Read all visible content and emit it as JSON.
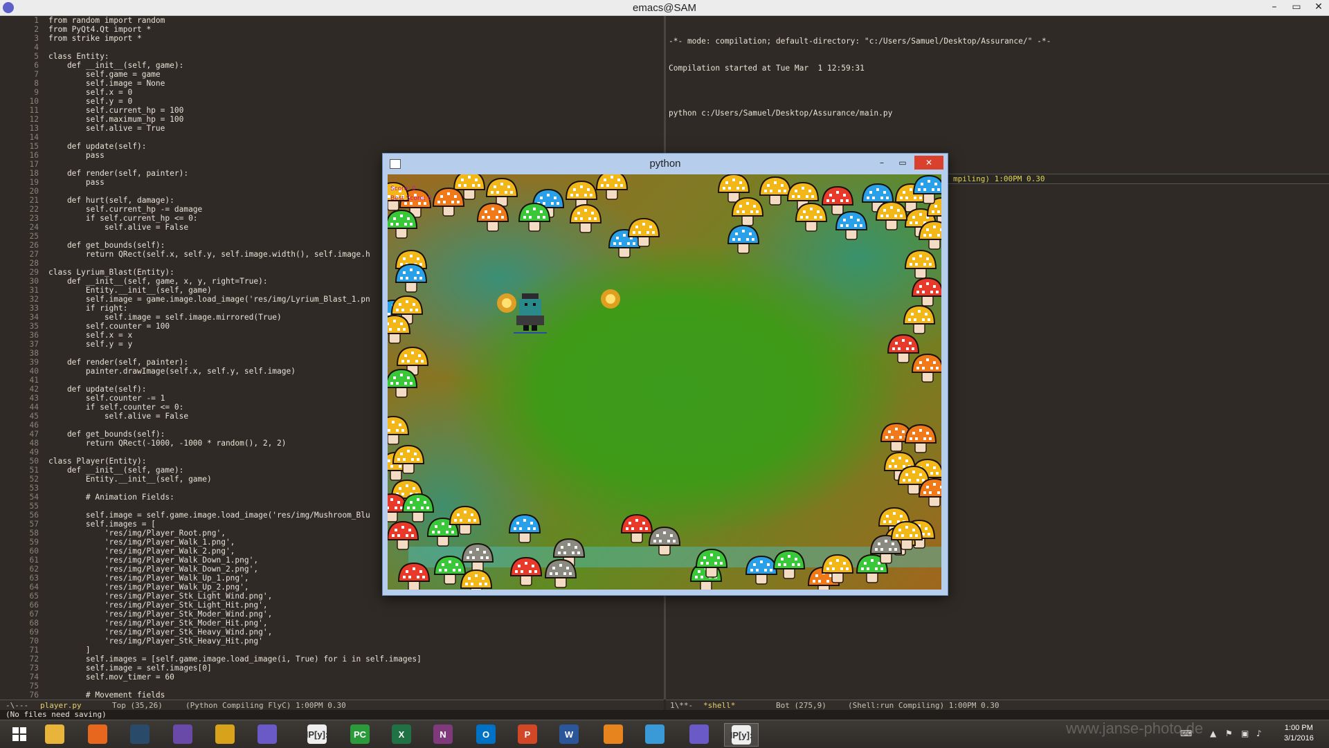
{
  "window": {
    "title": "emacs@SAM",
    "controls": [
      "–",
      "▭",
      "✕"
    ]
  },
  "editor": {
    "lines": [
      {
        "n": "1",
        "t": "from random import random"
      },
      {
        "n": "2",
        "t": "from PyQt4.Qt import *"
      },
      {
        "n": "3",
        "t": "from strike import *"
      },
      {
        "n": "4",
        "t": ""
      },
      {
        "n": "5",
        "t": "class Entity:"
      },
      {
        "n": "6",
        "t": "    def __init__(self, game):"
      },
      {
        "n": "7",
        "t": "        self.game = game"
      },
      {
        "n": "8",
        "t": "        self.image = None"
      },
      {
        "n": "9",
        "t": "        self.x = 0"
      },
      {
        "n": "10",
        "t": "        self.y = 0"
      },
      {
        "n": "11",
        "t": "        self.current_hp = 100"
      },
      {
        "n": "12",
        "t": "        self.maximum_hp = 100"
      },
      {
        "n": "13",
        "t": "        self.alive = True"
      },
      {
        "n": "14",
        "t": ""
      },
      {
        "n": "15",
        "t": "    def update(self):"
      },
      {
        "n": "16",
        "t": "        pass"
      },
      {
        "n": "17",
        "t": ""
      },
      {
        "n": "18",
        "t": "    def render(self, painter):"
      },
      {
        "n": "19",
        "t": "        pass"
      },
      {
        "n": "20",
        "t": ""
      },
      {
        "n": "21",
        "t": "    def hurt(self, damage):"
      },
      {
        "n": "22",
        "t": "        self.current_hp -= damage"
      },
      {
        "n": "23",
        "t": "        if self.current_hp <= 0:"
      },
      {
        "n": "24",
        "t": "            self.alive = False"
      },
      {
        "n": "25",
        "t": ""
      },
      {
        "n": "26",
        "t": "    def get_bounds(self):"
      },
      {
        "n": "27",
        "t": "        return QRect(self.x, self.y, self.image.width(), self.image.h"
      },
      {
        "n": "28",
        "t": ""
      },
      {
        "n": "29",
        "t": "class Lyrium_Blast(Entity):"
      },
      {
        "n": "30",
        "t": "    def __init__(self, game, x, y, right=True):"
      },
      {
        "n": "31",
        "t": "        Entity.__init__(self, game)"
      },
      {
        "n": "32",
        "t": "        self.image = game.image.load_image('res/img/Lyrium_Blast_1.pn"
      },
      {
        "n": "33",
        "t": "        if right:"
      },
      {
        "n": "34",
        "t": "            self.image = self.image.mirrored(True)"
      },
      {
        "n": "35",
        "t": "        self.counter = 100"
      },
      {
        "n": "36",
        "t": "        self.x = x"
      },
      {
        "n": "37",
        "t": "        self.y = y"
      },
      {
        "n": "38",
        "t": ""
      },
      {
        "n": "39",
        "t": "    def render(self, painter):"
      },
      {
        "n": "40",
        "t": "        painter.drawImage(self.x, self.y, self.image)"
      },
      {
        "n": "41",
        "t": ""
      },
      {
        "n": "42",
        "t": "    def update(self):"
      },
      {
        "n": "43",
        "t": "        self.counter -= 1"
      },
      {
        "n": "44",
        "t": "        if self.counter <= 0:"
      },
      {
        "n": "45",
        "t": "            self.alive = False"
      },
      {
        "n": "46",
        "t": ""
      },
      {
        "n": "47",
        "t": "    def get_bounds(self):"
      },
      {
        "n": "48",
        "t": "        return QRect(-1000, -1000 * random(), 2, 2)"
      },
      {
        "n": "49",
        "t": ""
      },
      {
        "n": "50",
        "t": "class Player(Entity):"
      },
      {
        "n": "51",
        "t": "    def __init__(self, game):"
      },
      {
        "n": "52",
        "t": "        Entity.__init__(self, game)"
      },
      {
        "n": "53",
        "t": ""
      },
      {
        "n": "54",
        "t": "        # Animation Fields:"
      },
      {
        "n": "55",
        "t": ""
      },
      {
        "n": "56",
        "t": "        self.image = self.game.image.load_image('res/img/Mushroom_Blu"
      },
      {
        "n": "57",
        "t": "        self.images = ["
      },
      {
        "n": "58",
        "t": "            'res/img/Player_Root.png',"
      },
      {
        "n": "59",
        "t": "            'res/img/Player_Walk_1.png',"
      },
      {
        "n": "60",
        "t": "            'res/img/Player_Walk_2.png',"
      },
      {
        "n": "61",
        "t": "            'res/img/Player_Walk_Down_1.png',"
      },
      {
        "n": "62",
        "t": "            'res/img/Player_Walk_Down_2.png',"
      },
      {
        "n": "63",
        "t": "            'res/img/Player_Walk_Up_1.png',"
      },
      {
        "n": "64",
        "t": "            'res/img/Player_Walk_Up_2.png',"
      },
      {
        "n": "65",
        "t": "            'res/img/Player_Stk_Light_Wind.png',"
      },
      {
        "n": "66",
        "t": "            'res/img/Player_Stk_Light_Hit.png',"
      },
      {
        "n": "67",
        "t": "            'res/img/Player_Stk_Moder_Wind.png',"
      },
      {
        "n": "68",
        "t": "            'res/img/Player_Stk_Moder_Hit.png',"
      },
      {
        "n": "69",
        "t": "            'res/img/Player_Stk_Heavy_Wind.png',"
      },
      {
        "n": "70",
        "t": "            'res/img/Player_Stk_Heavy_Hit.png'"
      },
      {
        "n": "71",
        "t": "        ]"
      },
      {
        "n": "72",
        "t": "        self.images = [self.game.image.load_image(i, True) for i in self.images]"
      },
      {
        "n": "73",
        "t": "        self.image = self.images[0]"
      },
      {
        "n": "74",
        "t": "        self.mov_timer = 60"
      },
      {
        "n": "75",
        "t": ""
      },
      {
        "n": "76",
        "t": "        # Movement fields"
      }
    ]
  },
  "shell": {
    "lines": [
      "-*- mode: compilation; default-directory: \"c:/Users/Samuel/Desktop/Assurance/\" -*-",
      "Compilation started at Tue Mar  1 12:59:31",
      "",
      "python c:/Users/Samuel/Desktop/Assurance/main.py"
    ],
    "mid_modeline": "mpiling) 1:00PM 0.30"
  },
  "modeline_left": {
    "status": "-\\---",
    "buffer": "player.py",
    "position": "Top (35,26)",
    "mode": "(Python Compiling FlyC) 1:00PM 0.30"
  },
  "modeline_right": {
    "status": "1\\**-",
    "buffer": "*shell*",
    "position": "Bot (275,9)",
    "mode": "(Shell:run Compiling) 1:00PM 0.30"
  },
  "echo": "(No files need saving)",
  "game": {
    "title": "python",
    "controls": [
      "–",
      "▭",
      "✕"
    ],
    "hud": [
      "Score: 0",
      "Best Score: 0"
    ]
  },
  "taskbar": {
    "apps": [
      {
        "name": "start",
        "label": "",
        "color": "#ffffff"
      },
      {
        "name": "file-explorer",
        "label": "",
        "color": "#e8b43a"
      },
      {
        "name": "firefox",
        "label": "",
        "color": "#e8671e"
      },
      {
        "name": "steam",
        "label": "",
        "color": "#2a4a6a"
      },
      {
        "name": "app-cat",
        "label": "",
        "color": "#6a4aa8"
      },
      {
        "name": "app-mango",
        "label": "",
        "color": "#d8a21a"
      },
      {
        "name": "emacs",
        "label": "",
        "color": "#6a5ac8"
      },
      {
        "name": "ipython",
        "label": "IP[y]:",
        "color": "#eeeeee"
      },
      {
        "name": "pycharm",
        "label": "PC",
        "color": "#2a9a3a"
      },
      {
        "name": "excel",
        "label": "X",
        "color": "#207245"
      },
      {
        "name": "onenote",
        "label": "N",
        "color": "#80397b"
      },
      {
        "name": "outlook",
        "label": "O",
        "color": "#0072c6"
      },
      {
        "name": "powerpoint",
        "label": "P",
        "color": "#d24726"
      },
      {
        "name": "word",
        "label": "W",
        "color": "#2b579a"
      },
      {
        "name": "app-orange",
        "label": "",
        "color": "#e8841e"
      },
      {
        "name": "app-tiles",
        "label": "",
        "color": "#3a9ad8"
      },
      {
        "name": "emacs-2",
        "label": "",
        "color": "#6a5ac8"
      },
      {
        "name": "ipython-2",
        "label": "IP[y]:",
        "color": "#eeeeee"
      }
    ],
    "watermark": "www.janse-photo.de",
    "time": "1:00 PM",
    "date": "3/1/2016"
  }
}
